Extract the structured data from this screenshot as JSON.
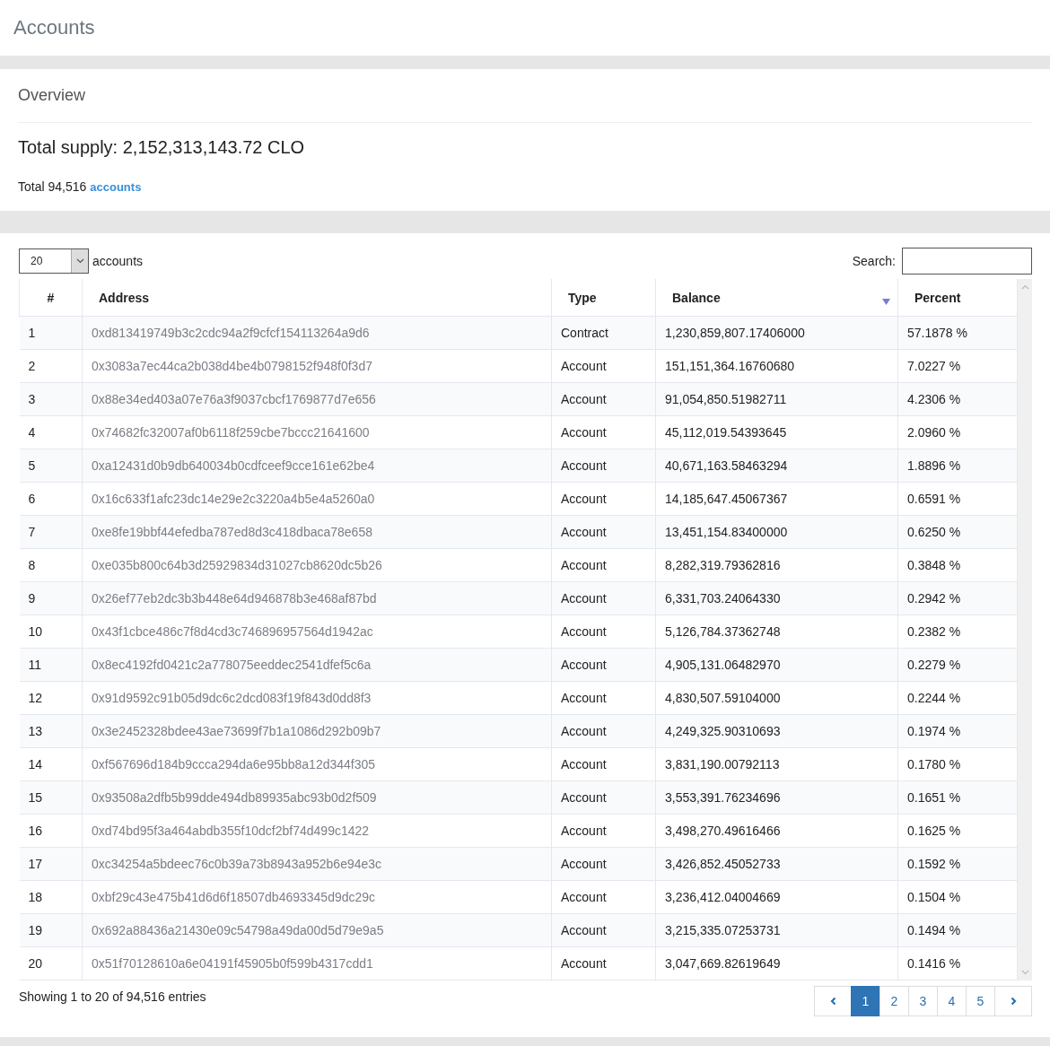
{
  "page_title": "Accounts",
  "overview": {
    "title": "Overview",
    "total_supply": "Total supply: 2,152,313,143.72 CLO",
    "total_prefix": "Total 94,516",
    "total_link": "accounts"
  },
  "table_controls": {
    "page_size": "20",
    "page_size_label": "accounts",
    "search_label": "Search:"
  },
  "columns": [
    {
      "label": "#",
      "sorted": false
    },
    {
      "label": "Address",
      "sorted": false
    },
    {
      "label": "Type",
      "sorted": false
    },
    {
      "label": "Balance",
      "sorted": true
    },
    {
      "label": "Percent",
      "sorted": false
    }
  ],
  "rows": [
    {
      "rank": "1",
      "address": "0xd813419749b3c2cdc94a2f9cfcf154113264a9d6",
      "type": "Contract",
      "balance": "1,230,859,807.17406000",
      "percent": "57.1878 %"
    },
    {
      "rank": "2",
      "address": "0x3083a7ec44ca2b038d4be4b0798152f948f0f3d7",
      "type": "Account",
      "balance": "151,151,364.16760680",
      "percent": "7.0227 %"
    },
    {
      "rank": "3",
      "address": "0x88e34ed403a07e76a3f9037cbcf1769877d7e656",
      "type": "Account",
      "balance": "91,054,850.51982711",
      "percent": "4.2306 %"
    },
    {
      "rank": "4",
      "address": "0x74682fc32007af0b6118f259cbe7bccc21641600",
      "type": "Account",
      "balance": "45,112,019.54393645",
      "percent": "2.0960 %"
    },
    {
      "rank": "5",
      "address": "0xa12431d0b9db640034b0cdfceef9cce161e62be4",
      "type": "Account",
      "balance": "40,671,163.58463294",
      "percent": "1.8896 %"
    },
    {
      "rank": "6",
      "address": "0x16c633f1afc23dc14e29e2c3220a4b5e4a5260a0",
      "type": "Account",
      "balance": "14,185,647.45067367",
      "percent": "0.6591 %"
    },
    {
      "rank": "7",
      "address": "0xe8fe19bbf44efedba787ed8d3c418dbaca78e658",
      "type": "Account",
      "balance": "13,451,154.83400000",
      "percent": "0.6250 %"
    },
    {
      "rank": "8",
      "address": "0xe035b800c64b3d25929834d31027cb8620dc5b26",
      "type": "Account",
      "balance": "8,282,319.79362816",
      "percent": "0.3848 %"
    },
    {
      "rank": "9",
      "address": "0x26ef77eb2dc3b3b448e64d946878b3e468af87bd",
      "type": "Account",
      "balance": "6,331,703.24064330",
      "percent": "0.2942 %"
    },
    {
      "rank": "10",
      "address": "0x43f1cbce486c7f8d4cd3c746896957564d1942ac",
      "type": "Account",
      "balance": "5,126,784.37362748",
      "percent": "0.2382 %"
    },
    {
      "rank": "11",
      "address": "0x8ec4192fd0421c2a778075eeddec2541dfef5c6a",
      "type": "Account",
      "balance": "4,905,131.06482970",
      "percent": "0.2279 %"
    },
    {
      "rank": "12",
      "address": "0x91d9592c91b05d9dc6c2dcd083f19f843d0dd8f3",
      "type": "Account",
      "balance": "4,830,507.59104000",
      "percent": "0.2244 %"
    },
    {
      "rank": "13",
      "address": "0x3e2452328bdee43ae73699f7b1a1086d292b09b7",
      "type": "Account",
      "balance": "4,249,325.90310693",
      "percent": "0.1974 %"
    },
    {
      "rank": "14",
      "address": "0xf567696d184b9ccca294da6e95bb8a12d344f305",
      "type": "Account",
      "balance": "3,831,190.00792113",
      "percent": "0.1780 %"
    },
    {
      "rank": "15",
      "address": "0x93508a2dfb5b99dde494db89935abc93b0d2f509",
      "type": "Account",
      "balance": "3,553,391.76234696",
      "percent": "0.1651 %"
    },
    {
      "rank": "16",
      "address": "0xd74bd95f3a464abdb355f10dcf2bf74d499c1422",
      "type": "Account",
      "balance": "3,498,270.49616466",
      "percent": "0.1625 %"
    },
    {
      "rank": "17",
      "address": "0xc34254a5bdeec76c0b39a73b8943a952b6e94e3c",
      "type": "Account",
      "balance": "3,426,852.45052733",
      "percent": "0.1592 %"
    },
    {
      "rank": "18",
      "address": "0xbf29c43e475b41d6d6f18507db4693345d9dc29c",
      "type": "Account",
      "balance": "3,236,412.04004669",
      "percent": "0.1504 %"
    },
    {
      "rank": "19",
      "address": "0x692a88436a21430e09c54798a49da00d5d79e9a5",
      "type": "Account",
      "balance": "3,215,335.07253731",
      "percent": "0.1494 %"
    },
    {
      "rank": "20",
      "address": "0x51f70128610a6e04191f45905b0f599b4317cdd1",
      "type": "Account",
      "balance": "3,047,669.82619649",
      "percent": "0.1416 %"
    }
  ],
  "footer": {
    "info": "Showing 1 to 20 of 94,516 entries"
  },
  "pagination": [
    {
      "label": "1",
      "selected": true
    },
    {
      "label": "2",
      "selected": false
    },
    {
      "label": "3",
      "selected": false
    },
    {
      "label": "4",
      "selected": false
    },
    {
      "label": "5",
      "selected": false
    }
  ]
}
